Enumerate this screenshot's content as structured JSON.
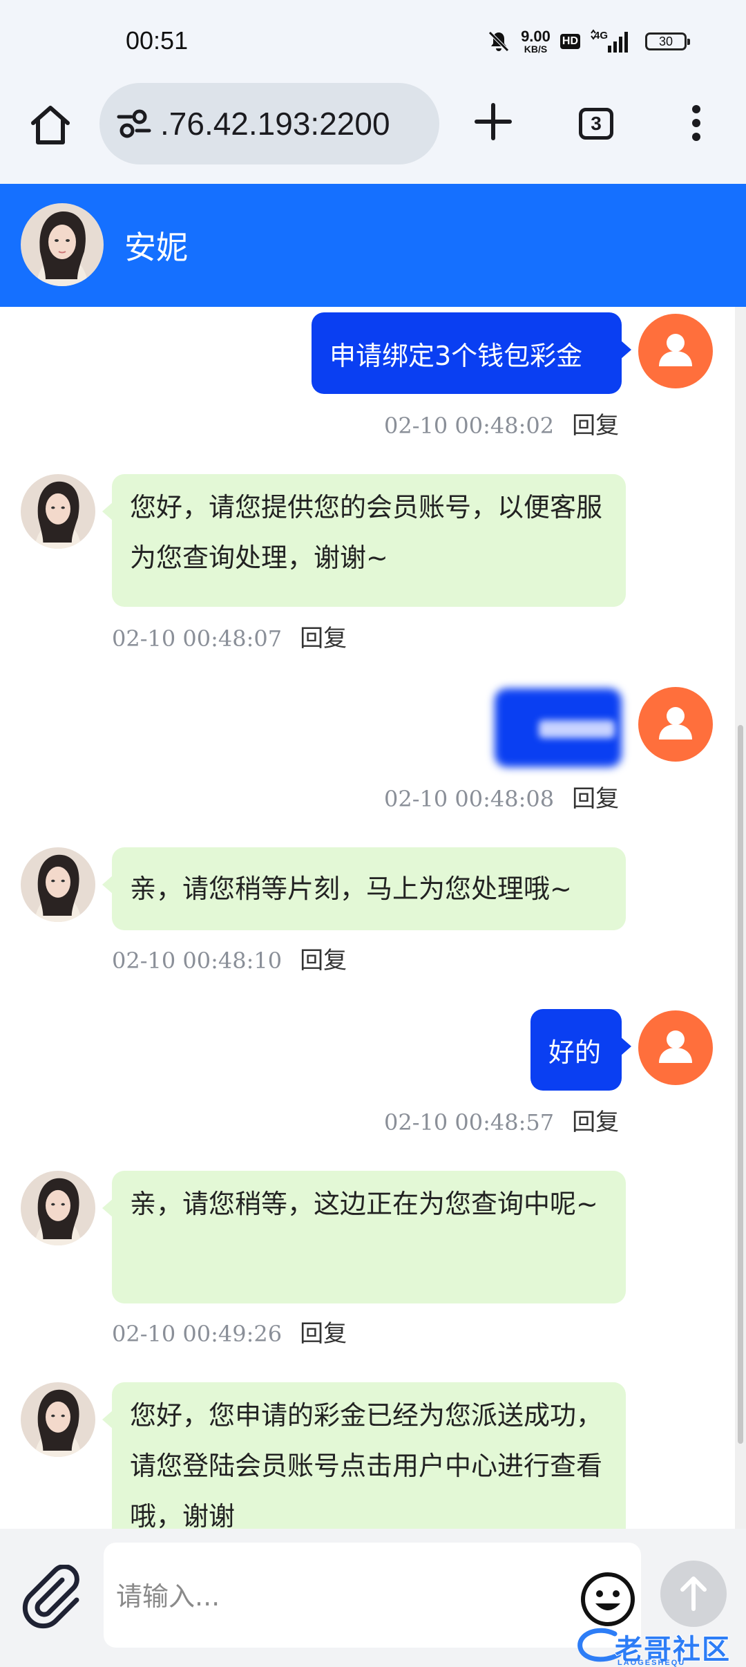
{
  "status_bar": {
    "time": "00:51",
    "net_speed_value": "9.00",
    "net_speed_unit": "KB/S",
    "hd_label": "HD",
    "network_label": "4G",
    "battery": "30",
    "icons": [
      "mute-bell-icon",
      "signal-icon",
      "battery-icon"
    ]
  },
  "browser": {
    "url": ".76.42.193:2200",
    "tab_count": "3",
    "icons": [
      "home-icon",
      "site-settings-icon",
      "new-tab-icon",
      "tabs-icon",
      "more-menu-icon"
    ]
  },
  "chat": {
    "contact_name": "安妮",
    "header_color": "#1570ff",
    "outgoing_bubble_color": "#0a3ff2",
    "incoming_bubble_color": "#e3f8d6",
    "user_avatar_color": "#ff6f3c",
    "reply_label": "回复",
    "messages": [
      {
        "dir": "out",
        "text": "申请绑定3个钱包彩金",
        "time": "02-10 00:48:02"
      },
      {
        "dir": "in",
        "text": "您好，请您提供您的会员账号，以便客服为您查询处理，谢谢~",
        "time": "02-10 00:48:07"
      },
      {
        "dir": "out",
        "text": "",
        "redacted": true,
        "time": "02-10 00:48:08"
      },
      {
        "dir": "in",
        "text": "亲，请您稍等片刻，马上为您处理哦~",
        "time": "02-10 00:48:10"
      },
      {
        "dir": "out",
        "text": "好的",
        "time": "02-10 00:48:57"
      },
      {
        "dir": "in",
        "text": "亲，请您稍等，这边正在为您查询中呢~",
        "time": "02-10 00:49:26"
      },
      {
        "dir": "in",
        "text": "您好，您申请的彩金已经为您派送成功，请您登陆会员账号点击用户中心进行查看哦，谢谢",
        "time": ""
      }
    ]
  },
  "input": {
    "placeholder": "请输入...",
    "icons": [
      "attachment-icon",
      "emoji-icon",
      "send-arrow-icon"
    ]
  },
  "watermark": {
    "text": "老哥社区",
    "subtext": "LAOGESHEQU"
  }
}
